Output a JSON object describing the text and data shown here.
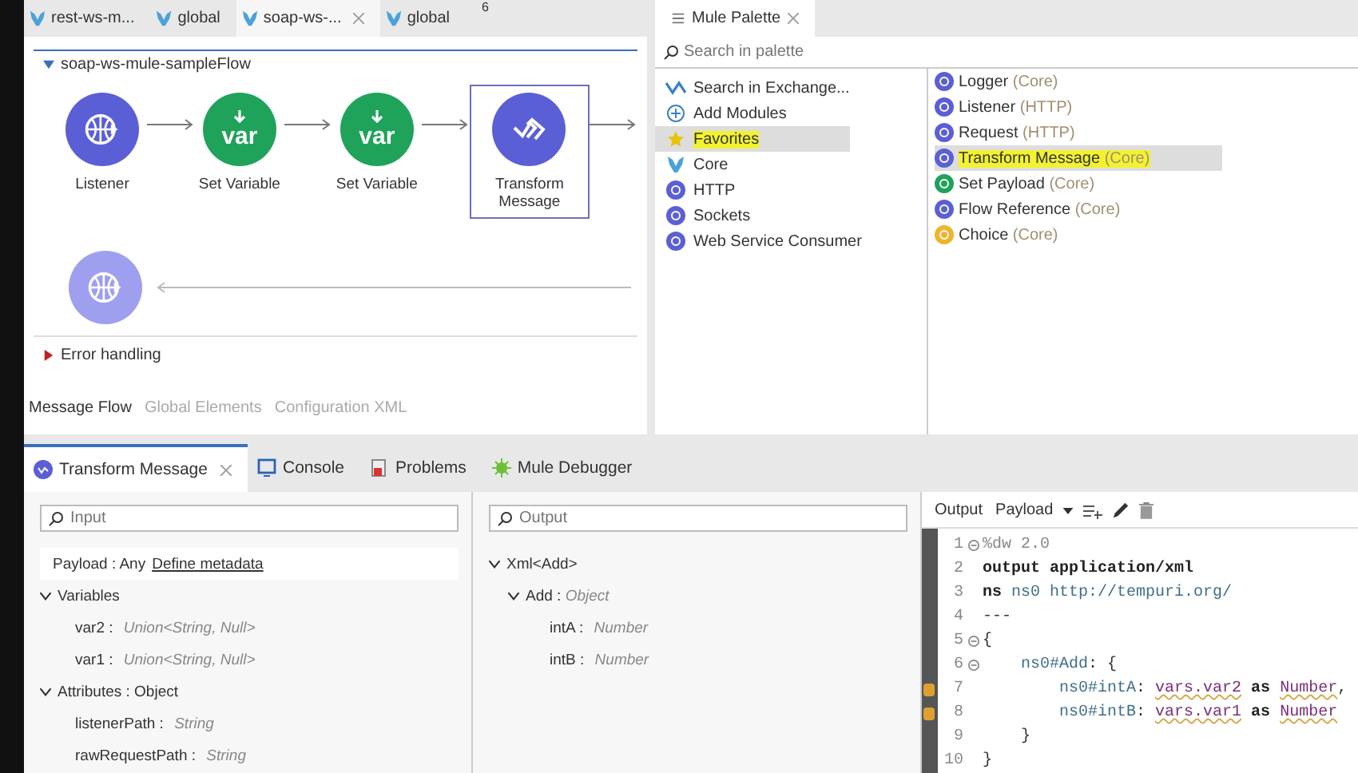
{
  "editor_tabs": [
    {
      "label": "rest-ws-m...",
      "selected": false,
      "closable": false
    },
    {
      "label": "global",
      "selected": false,
      "closable": false
    },
    {
      "label": "soap-ws-...",
      "selected": true,
      "closable": true
    },
    {
      "label": "global",
      "selected": false,
      "closable": false
    }
  ],
  "tab_overflow_count": "6",
  "flow": {
    "name": "soap-ws-mule-sampleFlow",
    "expanded": true,
    "nodes": [
      {
        "kind": "listener",
        "label": "Listener",
        "selected": false
      },
      {
        "kind": "variable",
        "label": "Set Variable",
        "icon_text": "var",
        "selected": false
      },
      {
        "kind": "variable",
        "label": "Set Variable",
        "icon_text": "var",
        "selected": false
      },
      {
        "kind": "transform",
        "label": "Transform\nMessage",
        "selected": true
      }
    ],
    "error_handling": "Error handling"
  },
  "view_tabs": [
    {
      "label": "Message Flow",
      "selected": true
    },
    {
      "label": "Global Elements",
      "selected": false
    },
    {
      "label": "Configuration XML",
      "selected": false
    }
  ],
  "palette": {
    "title": "Mule Palette",
    "search_placeholder": "Search in palette",
    "modules": [
      {
        "kind": "exchange",
        "label": "Search in Exchange...",
        "selected": false
      },
      {
        "kind": "add",
        "label": "Add Modules",
        "selected": false
      },
      {
        "kind": "favorites",
        "label": "Favorites",
        "selected": true
      },
      {
        "kind": "core",
        "label": "Core",
        "selected": false
      },
      {
        "kind": "module",
        "label": "HTTP",
        "selected": false
      },
      {
        "kind": "module",
        "label": "Sockets",
        "selected": false
      },
      {
        "kind": "module",
        "label": "Web Service Consumer",
        "selected": false
      }
    ],
    "components": [
      {
        "name": "Logger",
        "category": "(Core)",
        "color": "#5b5fd6",
        "selected": false
      },
      {
        "name": "Listener",
        "category": "(HTTP)",
        "color": "#5b5fd6",
        "selected": false
      },
      {
        "name": "Request",
        "category": "(HTTP)",
        "color": "#5b5fd6",
        "selected": false
      },
      {
        "name": "Transform Message",
        "category": "(Core)",
        "color": "#5b5fd6",
        "selected": true
      },
      {
        "name": "Set Payload",
        "category": "(Core)",
        "color": "#1fa35a",
        "selected": false
      },
      {
        "name": "Flow Reference",
        "category": "(Core)",
        "color": "#5b5fd6",
        "selected": false
      },
      {
        "name": "Choice",
        "category": "(Core)",
        "color": "#f0b429",
        "selected": false
      }
    ]
  },
  "bottom_tabs": [
    {
      "kind": "transform",
      "label": "Transform Message",
      "selected": true
    },
    {
      "kind": "console",
      "label": "Console",
      "selected": false
    },
    {
      "kind": "problems",
      "label": "Problems",
      "selected": false
    },
    {
      "kind": "debugger",
      "label": "Mule Debugger",
      "selected": false
    }
  ],
  "input": {
    "placeholder": "Input",
    "payload_label": "Payload : Any",
    "payload_link": "Define metadata",
    "tree": [
      {
        "name": "Variables",
        "expanded": true,
        "children": [
          {
            "name": "var2 :",
            "type": "Union<String, Null>"
          },
          {
            "name": "var1 :",
            "type": "Union<String, Null>"
          }
        ]
      },
      {
        "name": "Attributes : Object",
        "expanded": true,
        "children": [
          {
            "name": "listenerPath :",
            "type": "String"
          },
          {
            "name": "rawRequestPath :",
            "type": "String"
          }
        ]
      }
    ]
  },
  "output": {
    "placeholder": "Output",
    "tree": [
      {
        "name": "Xml<Add>",
        "expanded": true,
        "children": [
          {
            "name": "Add :",
            "type": "Object",
            "expanded": true,
            "children": [
              {
                "name": "intA :",
                "type": "Number"
              },
              {
                "name": "intB :",
                "type": "Number"
              }
            ]
          }
        ]
      }
    ]
  },
  "script": {
    "label": "Output",
    "target": "Payload",
    "lines": [
      {
        "number": "1",
        "fold": true,
        "warning": false,
        "segments": [
          {
            "text": "%dw 2.0",
            "kind": "directive"
          }
        ]
      },
      {
        "number": "2",
        "fold": false,
        "warning": false,
        "segments": [
          {
            "text": "output application/xml",
            "kind": "keyword"
          }
        ]
      },
      {
        "number": "3",
        "fold": false,
        "warning": false,
        "segments": [
          {
            "text": "ns ",
            "kind": "keyword"
          },
          {
            "text": "ns0 http://tempuri.org/",
            "kind": "ident"
          }
        ]
      },
      {
        "number": "4",
        "fold": false,
        "warning": false,
        "segments": [
          {
            "text": "---",
            "kind": "plain"
          }
        ]
      },
      {
        "number": "5",
        "fold": true,
        "warning": false,
        "segments": [
          {
            "text": "{",
            "kind": "plain"
          }
        ]
      },
      {
        "number": "6",
        "fold": true,
        "warning": false,
        "segments": [
          {
            "text": "    ns0#Add",
            "kind": "ident"
          },
          {
            "text": ": {",
            "kind": "plain"
          }
        ]
      },
      {
        "number": "7",
        "fold": false,
        "warning": true,
        "segments": [
          {
            "text": "        ns0#intA",
            "kind": "ident"
          },
          {
            "text": ": ",
            "kind": "plain"
          },
          {
            "text": "vars.var2",
            "kind": "var"
          },
          {
            "text": " as ",
            "kind": "keyword"
          },
          {
            "text": "Number",
            "kind": "type"
          },
          {
            "text": ",",
            "kind": "plain"
          }
        ]
      },
      {
        "number": "8",
        "fold": false,
        "warning": true,
        "segments": [
          {
            "text": "        ns0#intB",
            "kind": "ident"
          },
          {
            "text": ": ",
            "kind": "plain"
          },
          {
            "text": "vars.var1",
            "kind": "var"
          },
          {
            "text": " as ",
            "kind": "keyword"
          },
          {
            "text": "Number",
            "kind": "type"
          }
        ]
      },
      {
        "number": "9",
        "fold": false,
        "warning": false,
        "segments": [
          {
            "text": "    }",
            "kind": "plain"
          }
        ]
      },
      {
        "number": "10",
        "fold": false,
        "warning": false,
        "segments": [
          {
            "text": "}",
            "kind": "plain"
          }
        ]
      }
    ]
  }
}
